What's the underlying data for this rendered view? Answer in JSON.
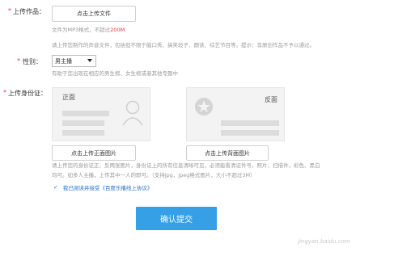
{
  "upload_work": {
    "label": "上传作品：",
    "button": "点击上传文件",
    "format_prefix": "文件为MP3格式，不超过",
    "format_limit": "200M"
  },
  "guidance": "请上传您制作的声音文件，包括但不限于脑口秀、搞笑段子、朗读、综艺节目等。提示：非原创作品不予以通过。",
  "gender": {
    "label": "性别：",
    "selected": "男主播",
    "hint": "有助于您出现在相应的男生榜、女生榜或者其他专题中"
  },
  "id_card": {
    "label": "上传身份证：",
    "front_title": "正面",
    "back_title": "反面",
    "front_button": "点击上传正面图片",
    "back_button": "点击上传背面图片",
    "instructions_line1": "请上传您的身份证正、反两张图片，身份证上的所有信息清晰可见，必须能看清证件号。照片、扫描件，彩色、黑白",
    "instructions_line2": "均可。如多人主播，上传其中一人的即可。（支持jpg，jpeg格式图片，大小不超过3M）"
  },
  "agreement": {
    "check": "✓",
    "text": "我已阅读并接受《百度乐播线上协议》"
  },
  "submit_label": "确认提交",
  "watermark": "jingyan.baidu.com"
}
